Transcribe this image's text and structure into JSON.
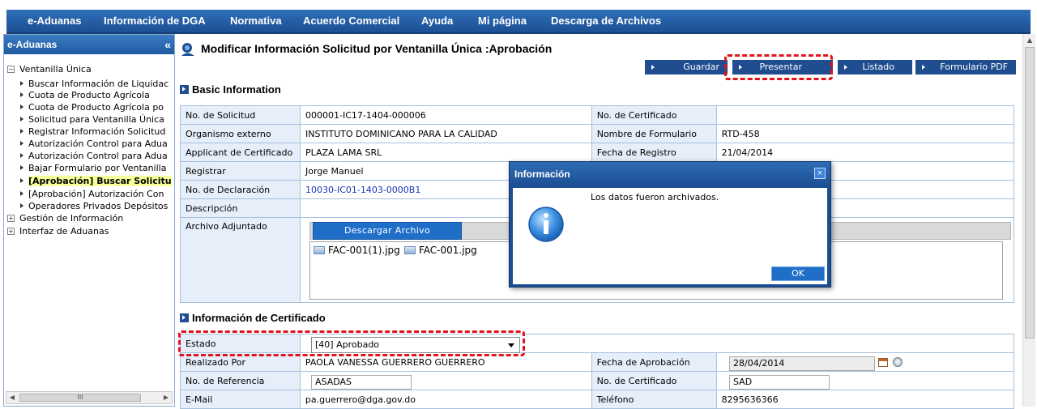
{
  "nav": [
    "e-Aduanas",
    "Información de DGA",
    "Normativa",
    "Acuerdo Comercial",
    "Ayuda",
    "Mi página",
    "Descarga de Archivos"
  ],
  "sidebar": {
    "title": "e-Aduanas",
    "collapse": "«",
    "root_toggle": "−",
    "root": "Ventanilla Única",
    "items": [
      "Buscar Información de Liquidac",
      "Cuota de Producto Agrícola",
      "Cuota de Producto Agrícola po",
      "Solicitud para Ventanilla Única",
      "Registrar Información Solicitud",
      "Autorización Control para Adua",
      "Autorización Control para Adua",
      "Bajar Formulario por Ventanilla",
      "[Aprobación] Buscar Solicitu",
      "[Aprobación] Autorización Con",
      "Operadores Privados Depósitos"
    ],
    "groups": [
      "Gestión de Información",
      "Interfaz de Aduanas"
    ],
    "group_toggle": "+",
    "scroll_thumb": "III"
  },
  "page": {
    "title": "Modificar Información Solicitud por Ventanilla Única :Aprobación",
    "buttons": [
      "Guardar",
      "Presentar",
      "Listado",
      "Formulario PDF"
    ]
  },
  "basic": {
    "section": "Basic Information",
    "labels": {
      "solicitud": "No. de Solicitud",
      "certificado": "No. de Certificado",
      "organismo": "Organismo externo",
      "formulario": "Nombre de Formulario",
      "applicant": "Applicant de Certificado",
      "fecha_registro": "Fecha de Registro",
      "registrar": "Registrar",
      "declaracion": "No. de Declaración",
      "descripcion": "Descripción",
      "archivo": "Archivo Adjuntado"
    },
    "values": {
      "solicitud": "000001-IC17-1404-000006",
      "certificado": "",
      "organismo": "INSTITUTO DOMINICANO PARA LA CALIDAD",
      "formulario": "RTD-458",
      "applicant": "PLAZA LAMA SRL",
      "fecha_registro": "21/04/2014",
      "registrar": "Jorge Manuel",
      "declaracion": "10030-IC01-1403-0000B1",
      "descripcion": ""
    },
    "download_button": "Descargar Archivo",
    "files": [
      "FAC-001(1).jpg",
      "FAC-001.jpg"
    ]
  },
  "cert": {
    "section": "Información de Certificado",
    "labels": {
      "estado": "Estado",
      "realizado": "Realizado Por",
      "fecha_aprobacion": "Fecha de Aprobación",
      "referencia": "No. de Referencia",
      "certificado": "No. de Certificado",
      "email": "E-Mail",
      "telefono": "Teléfono"
    },
    "values": {
      "estado": "[40] Aprobado",
      "realizado": "PAOLA VANESSA GUERRERO GUERRERO",
      "fecha_aprobacion": "28/04/2014",
      "referencia": "ASADAS",
      "certificado": "SAD",
      "email": "pa.guerrero@dga.gov.do",
      "telefono": "8295636366"
    }
  },
  "modal": {
    "title": "Información",
    "close": "×",
    "message": "Los datos fueron archivados.",
    "ok": "OK"
  },
  "colors": {
    "nav_blue": "#1f5aa0",
    "button_blue": "#1f4d8f",
    "highlight_red": "#e3131b",
    "selected_yellow": "#f6ff9a"
  }
}
